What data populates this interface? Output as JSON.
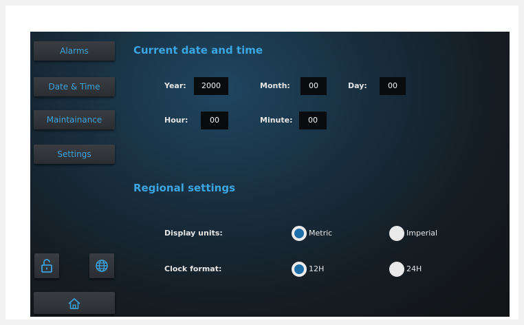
{
  "sidebar": {
    "items": [
      {
        "label": "Alarms"
      },
      {
        "label": "Date & Time"
      },
      {
        "label": "Maintainance"
      },
      {
        "label": "Settings"
      }
    ],
    "icons": {
      "lock": "unlock-icon",
      "language": "globe-icon",
      "home": "home-icon"
    }
  },
  "datetime": {
    "title": "Current date and time",
    "year_label": "Year:",
    "year_value": "2000",
    "month_label": "Month:",
    "month_value": "00",
    "day_label": "Day:",
    "day_value": "00",
    "hour_label": "Hour:",
    "hour_value": "00",
    "minute_label": "Minute:",
    "minute_value": "00"
  },
  "regional": {
    "title": "Regional settings",
    "units_label": "Display units:",
    "units_options": [
      "Metric",
      "Imperial"
    ],
    "units_selected": "Metric",
    "clock_label": "Clock format:",
    "clock_options": [
      "12H",
      "24H"
    ],
    "clock_selected": "12H"
  },
  "colors": {
    "accent": "#3ca6e2",
    "radio_selected": "#1f6fa8",
    "field_bg": "#090b0e"
  }
}
